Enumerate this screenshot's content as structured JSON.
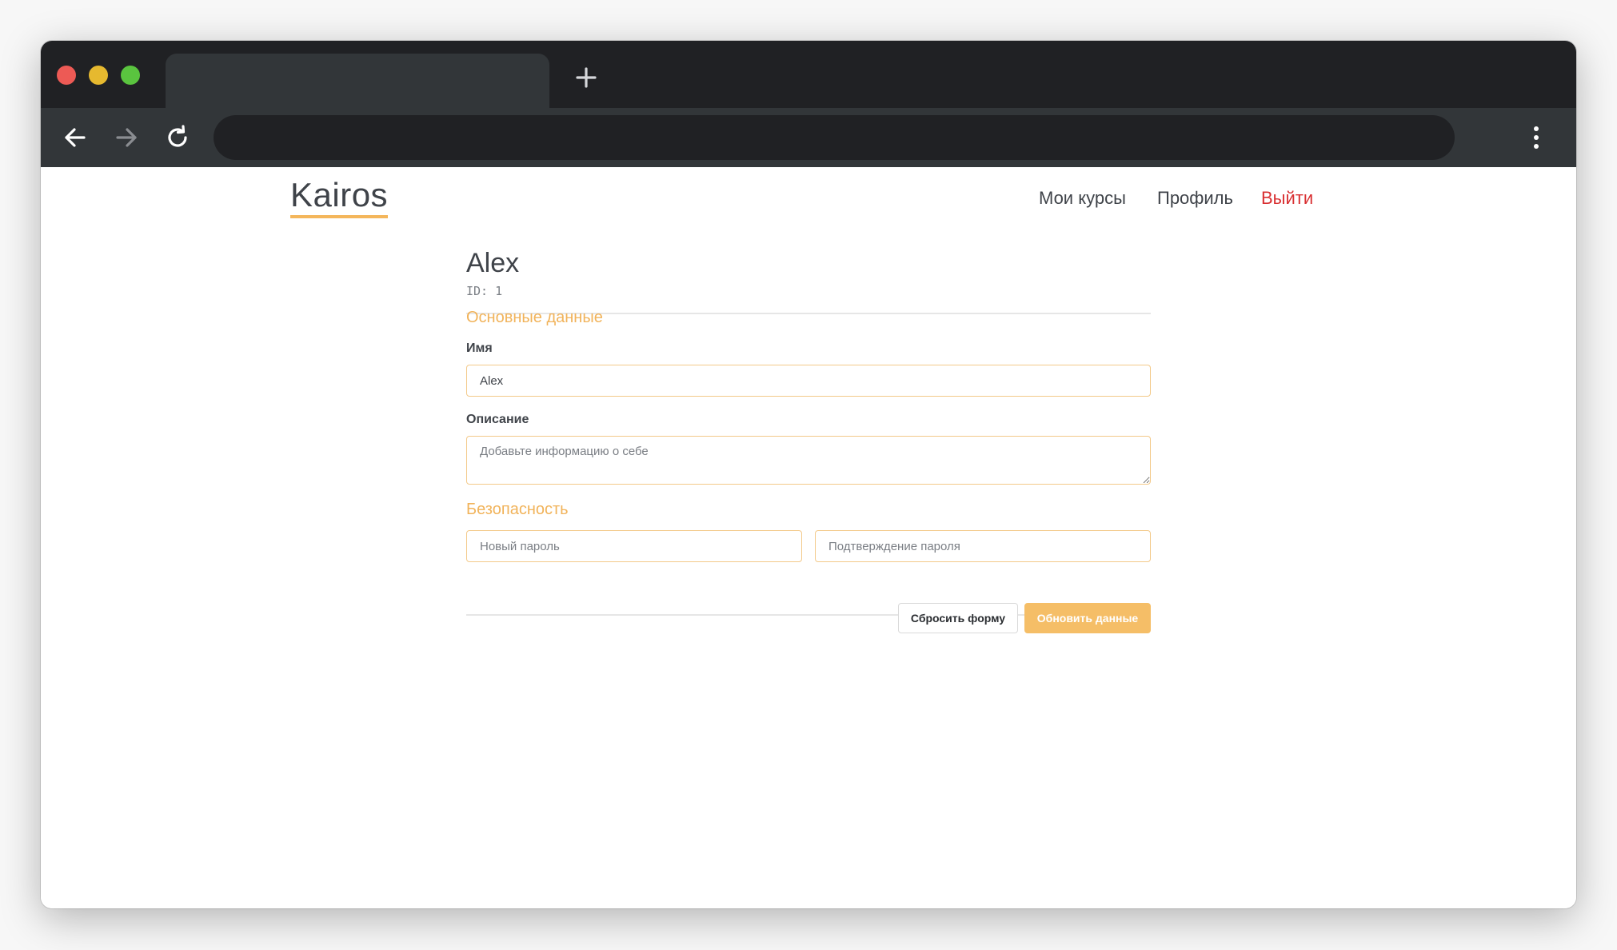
{
  "browser": {
    "tab_title": "",
    "address": "",
    "new_tab_icon": "plus-icon",
    "back_icon": "arrow-left-icon",
    "forward_icon": "arrow-right-icon",
    "reload_icon": "reload-icon",
    "menu_icon": "kebab-menu-icon",
    "traffic_colors": [
      "#ed5a55",
      "#e6b92f",
      "#5ac43f"
    ]
  },
  "header": {
    "logo": "Kairos",
    "nav": {
      "my_courses": "Мои курсы",
      "profile": "Профиль",
      "logout": "Выйти"
    }
  },
  "profile": {
    "name": "Alex",
    "id_label": "ID: 1"
  },
  "basic": {
    "title": "Основные данные",
    "name_label": "Имя",
    "name_value": "Alex",
    "description_label": "Описание",
    "description_placeholder": "Добавьте информацию о себе"
  },
  "security": {
    "title": "Безопасность",
    "new_password_placeholder": "Новый пароль",
    "confirm_password_placeholder": "Подтверждение пароля"
  },
  "actions": {
    "reset_label": "Сбросить форму",
    "submit_label": "Обновить данные"
  },
  "colors": {
    "accent": "#f1b35a",
    "logout": "#d93032",
    "text": "#3f4349"
  }
}
